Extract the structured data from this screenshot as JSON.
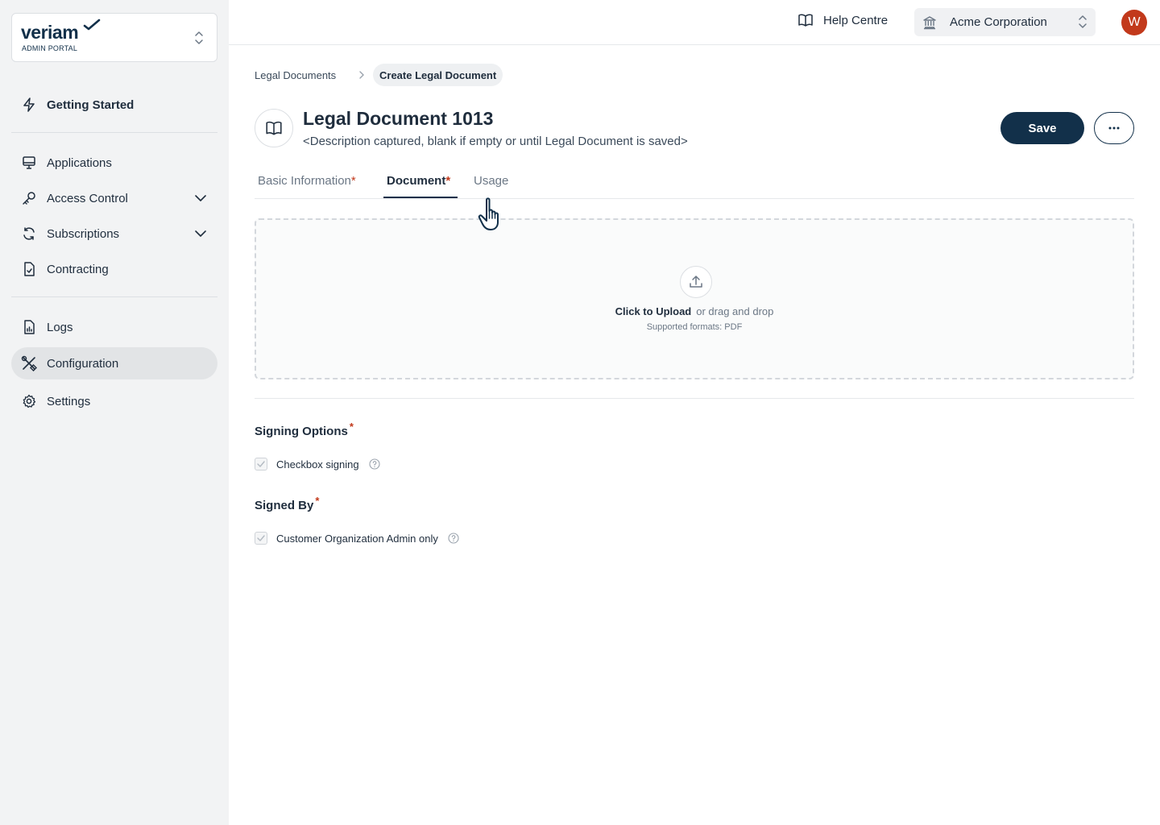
{
  "brand": {
    "name": "veriam",
    "subtitle": "ADMIN PORTAL"
  },
  "sidebar": {
    "items": [
      {
        "label": "Getting Started",
        "icon": "lightning-icon"
      },
      {
        "label": "Applications",
        "icon": "monitor-icon"
      },
      {
        "label": "Access Control",
        "icon": "key-icon",
        "expandable": true
      },
      {
        "label": "Subscriptions",
        "icon": "refresh-icon",
        "expandable": true
      },
      {
        "label": "Contracting",
        "icon": "file-signature-icon"
      },
      {
        "label": "Logs",
        "icon": "file-chart-icon"
      },
      {
        "label": "Configuration",
        "icon": "tools-icon",
        "active": true
      },
      {
        "label": "Settings",
        "icon": "gear-icon"
      }
    ]
  },
  "topbar": {
    "help_label": "Help Centre",
    "org_label": "Acme Corporation",
    "avatar_initial": "W"
  },
  "breadcrumb": {
    "parent": "Legal Documents",
    "current": "Create Legal Document"
  },
  "header": {
    "title": "Legal Document 1013",
    "description": "<Description captured, blank if empty or until Legal Document is saved>",
    "save_label": "Save",
    "more_label": "···"
  },
  "tabs": [
    {
      "label": "Basic Information",
      "required": "*",
      "active": false
    },
    {
      "label": "Document",
      "required": "*",
      "active": true
    },
    {
      "label": "Usage",
      "required": "",
      "active": false
    }
  ],
  "upload": {
    "action": "Click to Upload",
    "alt": "or drag and drop",
    "formats": "Supported formats: PDF"
  },
  "signing_options": {
    "title": "Signing Options",
    "required": "*",
    "option_label": "Checkbox signing",
    "checked": true
  },
  "signed_by": {
    "title": "Signed By",
    "required": "*",
    "option_label": "Customer Organization Admin only",
    "checked": true
  },
  "colors": {
    "primary": "#12304a",
    "required": "#c2391b",
    "avatar": "#c2391b",
    "sidebar_bg": "#f2f3f4"
  }
}
